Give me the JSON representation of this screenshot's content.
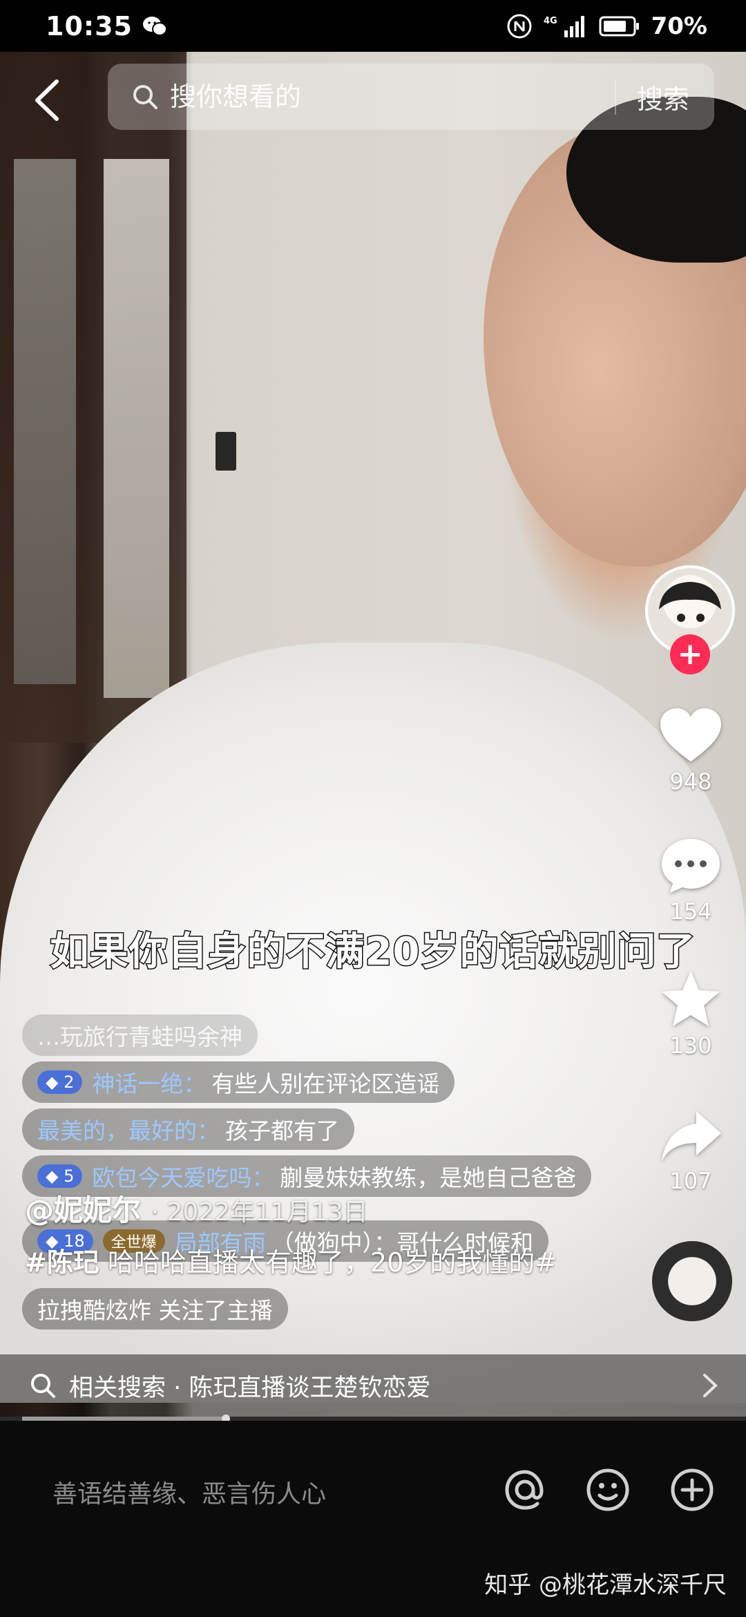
{
  "status_bar": {
    "time": "10:35",
    "network": "4G",
    "battery": "70%"
  },
  "search": {
    "placeholder": "搜你想看的",
    "button_label": "搜索"
  },
  "video": {
    "subtitle": "如果你自身的不满20岁的话就别问了"
  },
  "live_comments": [
    {
      "level": "",
      "nick": "",
      "text": "…玩旅行青蛙吗余神"
    },
    {
      "level": "2",
      "nick": "神话一绝：",
      "text": "有些人别在评论区造谣"
    },
    {
      "level": "",
      "nick": "最美的，最好的：",
      "text": "孩子都有了"
    },
    {
      "level": "5",
      "nick": "欧包今天爱吃吗：",
      "text": "蒯曼妹妹教练，是她自己爸爸"
    },
    {
      "level": "18",
      "tag": "全世爆",
      "nick": "局部有雨",
      "text": "（做狗中）：哥什么时候和"
    },
    {
      "level": "",
      "nick": "",
      "text": "拉拽酷炫炸 关注了主播"
    }
  ],
  "right_rail": {
    "like_count": "948",
    "comment_count": "154",
    "favorite_count": "130",
    "share_count": "107"
  },
  "author": {
    "name": "@妮妮尔",
    "date": "· 2022年11月13日"
  },
  "caption": {
    "hashtag": "#陈玘",
    "text": " 哈哈哈直播太有趣了，20岁的我懂的#"
  },
  "related": {
    "text": "相关搜索 · 陈玘直播谈王楚钦恋爱"
  },
  "playback": {
    "progress_fraction": 0.29
  },
  "bottom_bar": {
    "comment_placeholder": "善语结善缘、恶言伤人心",
    "watermark": "知乎 @桃花潭水深千尺"
  },
  "colors": {
    "follow_accent": "#fe2c55",
    "background": "#000000"
  }
}
